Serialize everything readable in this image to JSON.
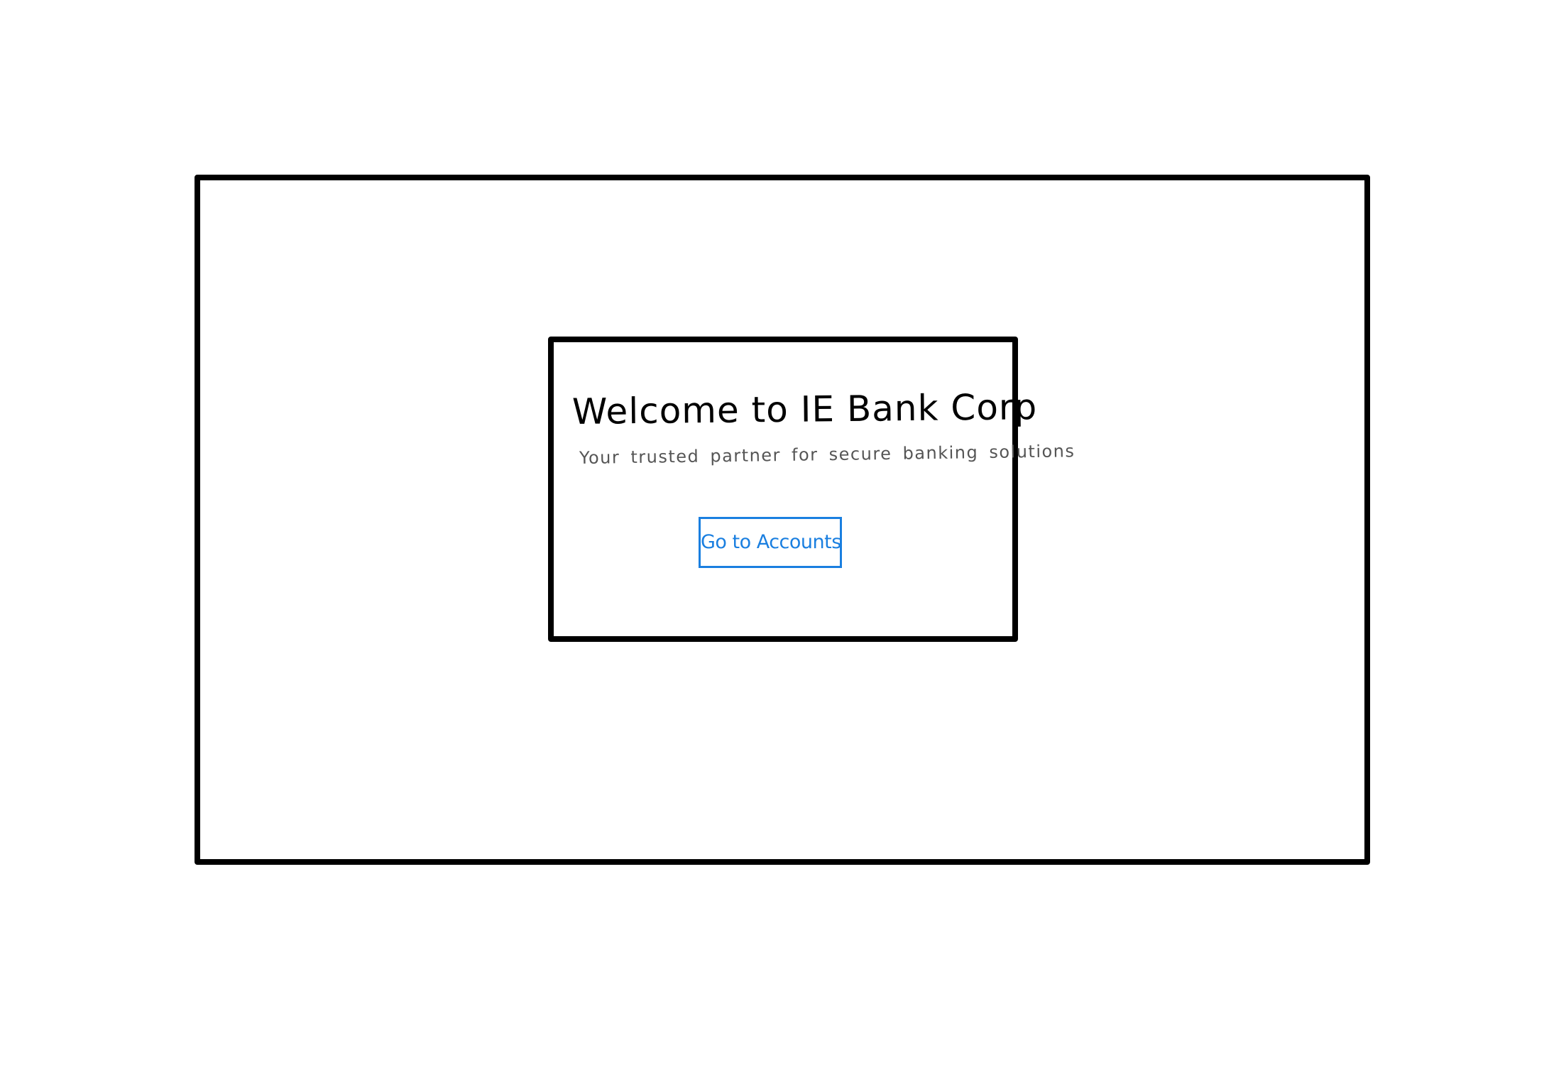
{
  "welcome": {
    "title": "Welcome to IE Bank Corp",
    "subtitle": "Your trusted partner for secure banking solutions",
    "button_label": "Go to Accounts"
  },
  "colors": {
    "frame_border": "#000000",
    "title_text": "#000000",
    "subtitle_text": "#555555",
    "button_accent": "#1a7fe0",
    "background": "#ffffff"
  }
}
